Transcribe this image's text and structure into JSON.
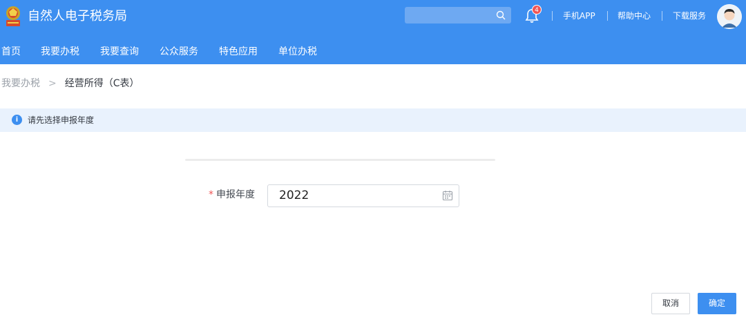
{
  "header": {
    "app_title": "自然人电子税务局",
    "search": {
      "placeholder": ""
    },
    "notification_count": "4",
    "links": [
      "手机APP",
      "帮助中心",
      "下载服务"
    ]
  },
  "nav": {
    "items": [
      "首页",
      "我要办税",
      "我要查询",
      "公众服务",
      "特色应用",
      "单位办税"
    ]
  },
  "breadcrumb": {
    "parent": "我要办税",
    "separator": ">",
    "current": "经营所得（C表）"
  },
  "notice": {
    "icon": "info-icon",
    "text": "请先选择申报年度"
  },
  "form": {
    "year_label": "申报年度",
    "required_mark": "*",
    "year_value": "2022"
  },
  "actions": {
    "cancel_label": "取消",
    "confirm_label": "确定"
  },
  "colors": {
    "primary": "#3d8ff0",
    "notice_bg": "#e9f2fd",
    "badge": "#f05454"
  }
}
